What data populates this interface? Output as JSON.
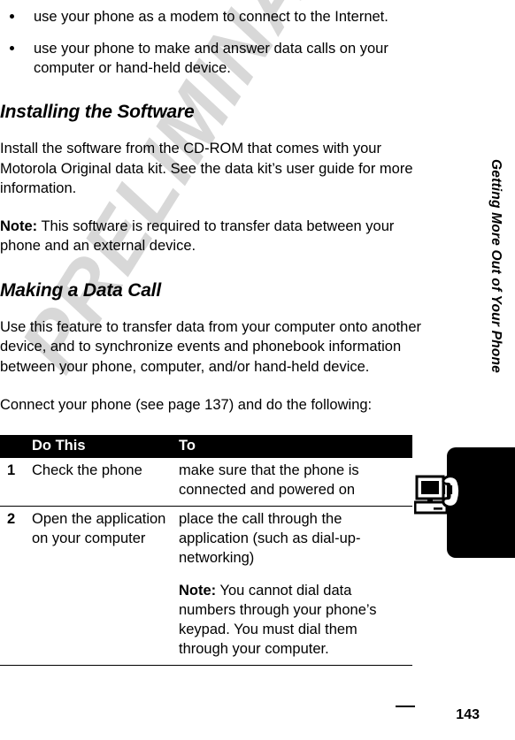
{
  "page": {
    "number": "143",
    "watermark": "PRELIMINARY",
    "side_title": "Getting More Out of Your Phone",
    "margin_icon": "computer-phone-icon"
  },
  "colors": {
    "text": "#000000",
    "background": "#ffffff",
    "watermark": "#d8d8d8",
    "table_header_bg": "#000000",
    "table_header_text": "#ffffff",
    "side_tab": "#000000"
  },
  "intro_bullets": [
    "use your phone as a modem to connect to the Internet.",
    "use your phone to make and answer data calls on your computer or hand-held device."
  ],
  "sections": [
    {
      "heading": "Installing the Software",
      "paragraphs": [
        {
          "text": "Install the software from the CD-ROM that comes with your Motorola Original data kit. See the data kit’s user guide for more information."
        },
        {
          "note_label": "Note:",
          "text": " This software is required to transfer data between your phone and an external device."
        }
      ]
    },
    {
      "heading": "Making a Data Call",
      "paragraphs": [
        {
          "text": "Use this feature to transfer data from your computer onto another device, and to synchronize events and phonebook information between your phone, computer, and/or hand-held device."
        },
        {
          "text": "Connect your phone (see page 137) and do the following:"
        }
      ]
    }
  ],
  "step_table": {
    "headers": {
      "num": "",
      "do_this": "Do This",
      "to": "To"
    },
    "rows": [
      {
        "num": "1",
        "do_this": "Check the phone",
        "to_primary": "make sure that the phone is connected and powered on",
        "to_note_label": "",
        "to_note_text": ""
      },
      {
        "num": "2",
        "do_this": "Open the application on your computer",
        "to_primary": "place the call through the application (such as dial-up-networking)",
        "to_note_label": "Note:",
        "to_note_text": " You cannot dial data numbers through your phone’s keypad. You must dial them through your computer."
      }
    ]
  }
}
